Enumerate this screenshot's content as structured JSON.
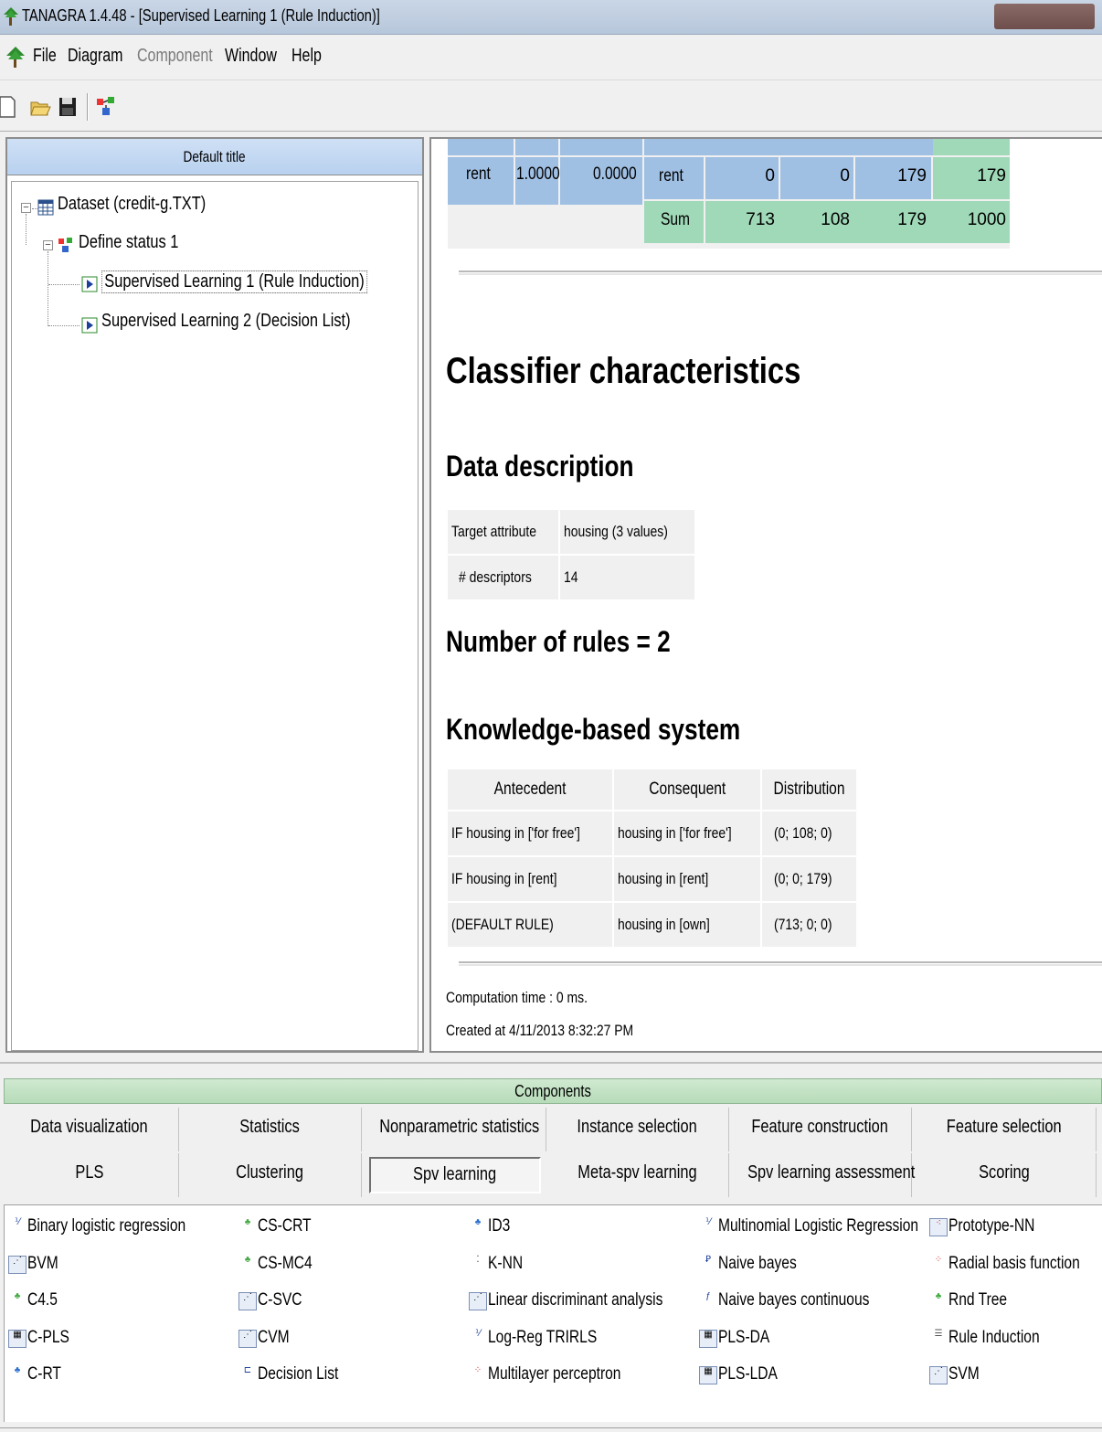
{
  "window": {
    "title": "TANAGRA 1.4.48 - [Supervised Learning 1 (Rule Induction)]"
  },
  "menu": [
    "File",
    "Diagram",
    "Component",
    "Window",
    "Help"
  ],
  "left_panel": {
    "header": "Default title",
    "tree": [
      "Dataset (credit-g.TXT)",
      "Define status 1",
      "Supervised Learning 1 (Rule Induction)",
      "Supervised Learning 2 (Decision List)"
    ]
  },
  "report": {
    "top_table": {
      "left": [
        "rent",
        "1.0000",
        "0.0000"
      ],
      "rent_row": [
        "rent",
        "0",
        "0",
        "179",
        "179"
      ],
      "sum_row": [
        "Sum",
        "713",
        "108",
        "179",
        "1000"
      ]
    },
    "section_title": "Classifier characteristics",
    "data_description": {
      "heading": "Data description",
      "rows": [
        [
          "Target attribute",
          "housing (3 values)"
        ],
        [
          "# descriptors",
          "14"
        ]
      ]
    },
    "rules_count": "Number of rules = 2",
    "kb": {
      "heading": "Knowledge-based system",
      "headers": [
        "Antecedent",
        "Consequent",
        "Distribution"
      ],
      "rows": [
        [
          "IF housing in ['for free']",
          "housing in ['for free']",
          "(0; 108; 0)"
        ],
        [
          "IF housing in [rent]",
          "housing in [rent]",
          "(0; 0; 179)"
        ],
        [
          "(DEFAULT RULE)",
          "housing in [own]",
          "(713; 0; 0)"
        ]
      ]
    },
    "computation_time": "Computation time : 0 ms.",
    "created_at": "Created at 4/11/2013 8:32:27 PM"
  },
  "components": {
    "header": "Components",
    "tabs_row1": [
      "Data visualization",
      "Statistics",
      "Nonparametric statistics",
      "Instance selection",
      "Feature construction",
      "Feature selection"
    ],
    "tabs_row2": [
      "PLS",
      "Clustering",
      "Spv learning",
      "Meta-spv learning",
      "Spv learning assessment",
      "Scoring"
    ],
    "active_tab": "Spv learning",
    "col1": [
      "Binary logistic regression",
      "BVM",
      "C4.5",
      "C-PLS",
      "C-RT"
    ],
    "col2": [
      "CS-CRT",
      "CS-MC4",
      "C-SVC",
      "CVM",
      "Decision List"
    ],
    "col3": [
      "ID3",
      "K-NN",
      "Linear discriminant analysis",
      "Log-Reg TRIRLS",
      "Multilayer perceptron"
    ],
    "col4": [
      "Multinomial Logistic Regression",
      "Naive bayes",
      "Naive bayes continuous",
      "PLS-DA",
      "PLS-LDA"
    ],
    "col5": [
      "Prototype-NN",
      "Radial basis function",
      "Rnd Tree",
      "Rule Induction",
      "SVM"
    ]
  },
  "colors": {
    "blue_cell": "#9fbfe3",
    "green_cell": "#9fd9b8",
    "header_blue": "#c4d9f2",
    "header_green": "#c2e3c4"
  }
}
